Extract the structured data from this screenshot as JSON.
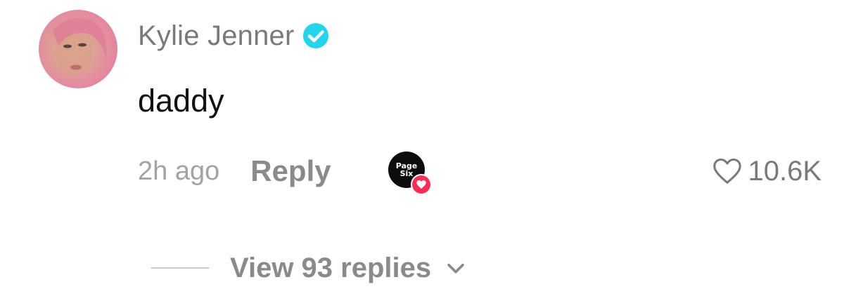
{
  "comment": {
    "username": "Kylie Jenner",
    "verified": true,
    "text": "daddy",
    "timestamp": "2h ago",
    "reply_label": "Reply",
    "creator_like_badge_text": [
      "Page",
      "Six"
    ],
    "like_count": "10.6K",
    "view_replies_label": "View 93 replies"
  },
  "icons": {
    "verified": "verified-badge-icon",
    "heart": "heart-outline-icon",
    "chevron": "chevron-down-icon",
    "creator_heart": "heart-filled-icon"
  },
  "colors": {
    "verified": "#20d5ec",
    "creator_heart": "#fe2c55",
    "muted_text": "#8a8a8a",
    "comment_text": "#111111"
  }
}
